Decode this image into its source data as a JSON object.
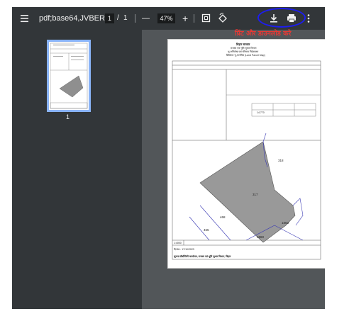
{
  "toolbar": {
    "title": "pdf;base64,JVBERi...",
    "page_current": "1",
    "page_separator": "/",
    "page_total": "1",
    "zoom_minus": "—",
    "zoom": "47%",
    "zoom_plus": "+"
  },
  "sidebar": {
    "thumb_page_number": "1"
  },
  "annotation": {
    "text": "प्रिंट और डाउनलोड करे"
  },
  "page": {
    "header_title": "बिहार सरकार",
    "header_line2": "राजस्व एवं भूमि सुधार विभाग",
    "header_line3": "भू अभिलेख एवं परिमाप निदेशालय",
    "header_line4": "डिजिटल भू-मानचित्र (Land Parcel Map)",
    "map_labels": {
      "parcel": "317",
      "top_right": "318",
      "left": "468",
      "bottom_left": "465",
      "bottom_right": "1863",
      "bottom": "1860"
    },
    "scale_value": "1:4000",
    "date": "दिनांक : 17/10/2023",
    "footer": "सूचना प्रौद्योगिकी कार्यालय, राजस्व एवं भूमि सुधार विभाग, बिहार",
    "area_value": "14.770"
  }
}
